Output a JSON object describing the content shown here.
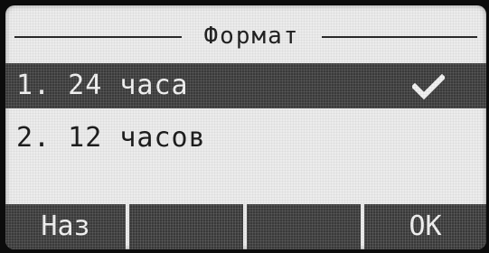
{
  "header": {
    "title": "Формат"
  },
  "menu": {
    "items": [
      {
        "label": "1. 24 часа",
        "selected": true,
        "checked": true
      },
      {
        "label": "2. 12 часов",
        "selected": false,
        "checked": false
      }
    ]
  },
  "softkeys": {
    "back_label": "Наз",
    "key2_label": "",
    "key3_label": "",
    "ok_label": "OK"
  },
  "icons": {
    "check": "checkmark-icon"
  },
  "colors": {
    "lcd_background": "#ececec",
    "highlight": "#3a3a3a",
    "text_dark": "#1e1e1e",
    "text_light": "#f2f2f2"
  }
}
